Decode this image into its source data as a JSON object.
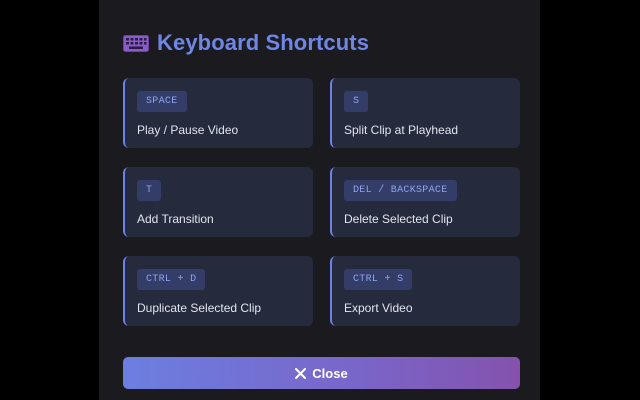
{
  "dialog": {
    "title": "Keyboard Shortcuts",
    "title_icon": "keyboard-icon",
    "accent_color": "#6f86e6"
  },
  "shortcuts": [
    {
      "key": "SPACE",
      "action": "Play / Pause Video"
    },
    {
      "key": "S",
      "action": "Split Clip at Playhead"
    },
    {
      "key": "T",
      "action": "Add Transition"
    },
    {
      "key": "DEL / BACKSPACE",
      "action": "Delete Selected Clip"
    },
    {
      "key": "CTRL + D",
      "action": "Duplicate Selected Clip"
    },
    {
      "key": "CTRL + S",
      "action": "Export Video"
    }
  ],
  "close_button": {
    "label": "Close",
    "icon": "close-icon"
  }
}
